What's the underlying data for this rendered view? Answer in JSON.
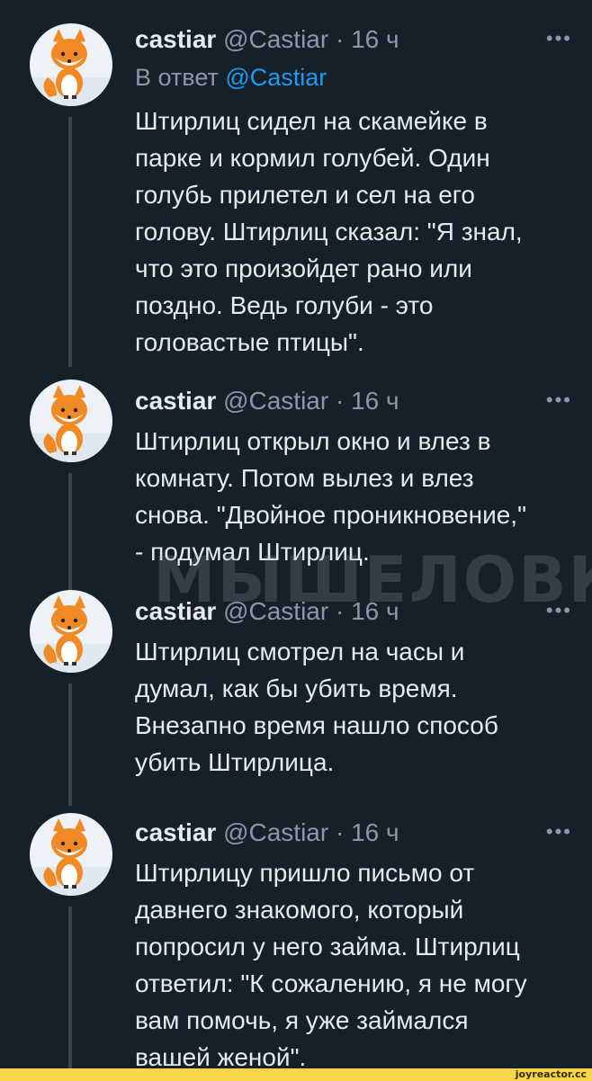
{
  "tweets": [
    {
      "name": "castiar",
      "handle": "@Castiar",
      "time": "· 16 ч",
      "reply_prefix": "В ответ",
      "reply_handle": "@Castiar",
      "text": "Штирлиц сидел на скамейке в\nпарке и кормил голубей. Один\nголубь прилетел и сел на его\nголову. Штирлиц сказал: \"Я знал,\nчто это произойдет рано или\nпоздно. Ведь голуби - это\nголовастые птицы\"."
    },
    {
      "name": "castiar",
      "handle": "@Castiar",
      "time": "· 16 ч",
      "text": "Штирлиц открыл окно и влез в\nкомнату. Потом вылез и влез\nснова. \"Двойное проникновение,\"\n- подумал Штирлиц."
    },
    {
      "name": "castiar",
      "handle": "@Castiar",
      "time": "· 16 ч",
      "text": "Штирлиц смотрел на часы и\nдумал, как бы убить время.\nВнезапно время нашло способ\nубить Штирлица."
    },
    {
      "name": "castiar",
      "handle": "@Castiar",
      "time": "· 16 ч",
      "text": "Штирлицу пришло письмо от\nдавнего знакомого, который\nпопросил у него займа. Штирлиц\nответил: \"К сожалению, я не могу\nвам помочь, я уже займался\nвашей женой\"."
    }
  ],
  "more_label": "•••",
  "watermark": "МЫШЕЛОВКА",
  "footer": "joyreactor.cc",
  "colors": {
    "background": "#15202b",
    "text": "#e7e9ea",
    "muted": "#8b98a5",
    "link": "#1d9bf0",
    "thread_line": "#38444d",
    "footer_bar": "#f7d54a"
  },
  "icons": [
    "fox-avatar-icon",
    "more-options-icon"
  ]
}
